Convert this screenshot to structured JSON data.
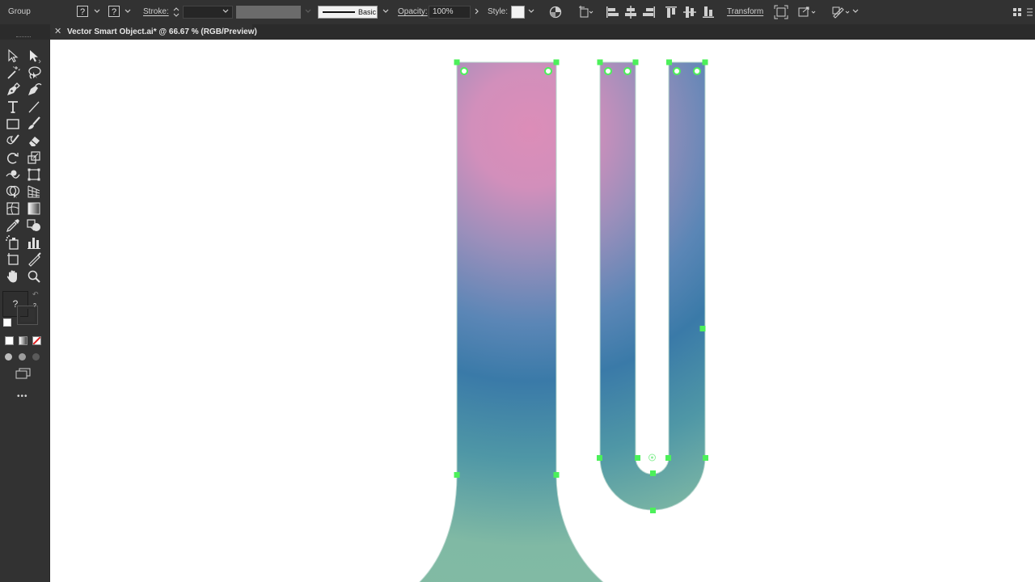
{
  "control_bar": {
    "selection_type": "Group",
    "fill_swatch": "?",
    "stroke_swatch": "?",
    "stroke_label": "Stroke:",
    "stroke_weight": "",
    "variable_width_preset": "",
    "brush_definition": "Basic",
    "opacity_label": "Opacity:",
    "opacity_value": "100%",
    "style_label": "Style:",
    "transform_label": "Transform"
  },
  "document_tab": {
    "title": "Vector Smart Object.ai* @ 66.67 % (RGB/Preview)"
  },
  "toolbar": {
    "tools": [
      "selection-tool",
      "direct-selection-tool",
      "magic-wand-tool",
      "lasso-tool",
      "pen-tool",
      "curvature-tool",
      "type-tool",
      "line-segment-tool",
      "rectangle-tool",
      "paintbrush-tool",
      "shaper-tool",
      "eraser-tool",
      "rotate-tool",
      "scale-tool",
      "warp-tool",
      "free-transform-tool",
      "shape-builder-tool",
      "perspective-grid-tool",
      "mesh-tool",
      "gradient-tool",
      "eyedropper-tool",
      "blend-tool",
      "symbol-sprayer-tool",
      "column-graph-tool",
      "artboard-tool",
      "slice-tool",
      "hand-tool",
      "zoom-tool"
    ],
    "fill_indicator": "?",
    "stroke_indicator": "?",
    "color_modes": [
      "color",
      "gradient",
      "none"
    ],
    "more_tools": "•••"
  },
  "colors": {
    "ui_dark": "#323232",
    "selection_handle": "#4cf05a",
    "gradient_pink": "#dc8db8",
    "gradient_purple": "#9b8fbb",
    "gradient_blue": "#3a7aa8",
    "gradient_teal": "#80b9a4"
  }
}
